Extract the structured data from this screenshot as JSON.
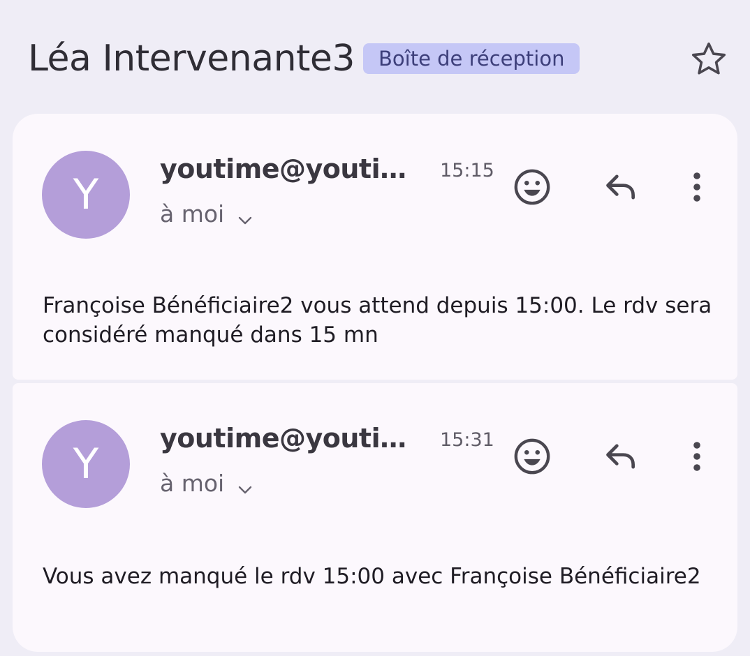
{
  "header": {
    "title": "Léa Intervenante3",
    "label": "Boîte de réception",
    "star_icon": "star-outline-icon"
  },
  "messages": [
    {
      "avatar_letter": "Y",
      "sender": "youtime@youtime.fr",
      "time": "15:15",
      "recipient": "à moi",
      "body": "Françoise Bénéficiaire2 vous attend depuis 15:00. Le rdv sera considéré manqué dans 15 mn"
    },
    {
      "avatar_letter": "Y",
      "sender": "youtime@youtime.fr",
      "time": "15:31",
      "recipient": "à moi",
      "body": "Vous avez manqué le rdv 15:00 avec Françoise Bénéficiaire2"
    }
  ],
  "colors": {
    "background": "#efedf6",
    "card": "#fcf8fd",
    "avatar": "#b49ed9",
    "label_chip": "#c5c7f6"
  }
}
